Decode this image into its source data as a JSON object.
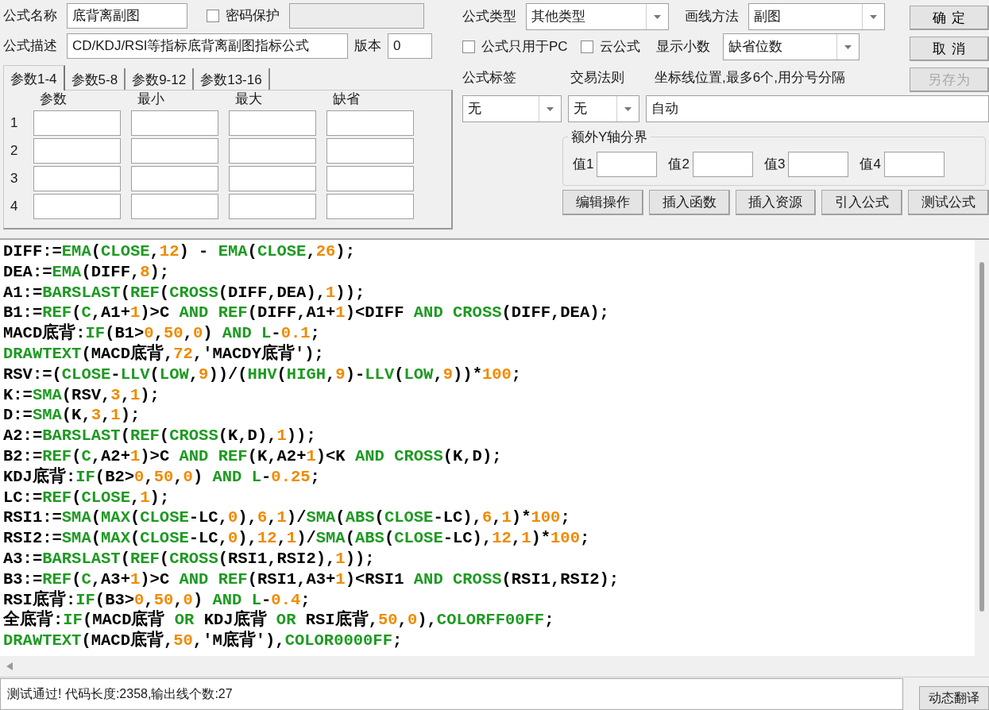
{
  "form": {
    "name_label": "公式名称",
    "name_value": "底背离副图",
    "password": {
      "label": "密码保护",
      "checked": false
    },
    "description_label": "公式描述",
    "description_value": "CD/KDJ/RSI等指标底背离副图指标公式",
    "version_label": "版本",
    "version_value": "0"
  },
  "param_tabs": [
    {
      "label": "参数1-4",
      "selected": true
    },
    {
      "label": "参数5-8",
      "selected": false
    },
    {
      "label": "参数9-12",
      "selected": false
    },
    {
      "label": "参数13-16",
      "selected": false
    }
  ],
  "param_columns": [
    "参数",
    "最小",
    "最大",
    "缺省"
  ],
  "param_rows": [
    "1",
    "2",
    "3",
    "4"
  ],
  "formula_type": {
    "label": "公式类型",
    "value": "其他类型"
  },
  "draw_method": {
    "label": "画线方法",
    "value": "副图"
  },
  "pc_only": {
    "label": "公式只用于PC",
    "checked": false
  },
  "cloud": {
    "label": "云公式",
    "checked": false
  },
  "decimals": {
    "label": "显示小数",
    "value": "缺省位数"
  },
  "tag": {
    "label": "公式标签",
    "value": "无"
  },
  "trade_rule": {
    "label": "交易法则",
    "value": "无"
  },
  "axis_lines": {
    "label": "坐标线位置,最多6个,用分号分隔",
    "value": "自动"
  },
  "y_bounds": {
    "title": "额外Y轴分界",
    "fields": [
      "值1",
      "值2",
      "值3",
      "值4"
    ]
  },
  "actions": [
    "编辑操作",
    "插入函数",
    "插入资源",
    "引入公式",
    "测试公式"
  ],
  "dialog_buttons": [
    {
      "label": "确 定",
      "disabled": false
    },
    {
      "label": "取 消",
      "disabled": false
    },
    {
      "label": "另存为",
      "disabled": true
    }
  ],
  "code_lines": [
    [
      {
        "kind": "text",
        "text": "DIFF:="
      },
      {
        "kind": "fn",
        "text": "EMA"
      },
      {
        "kind": "text",
        "text": "("
      },
      {
        "kind": "fn",
        "text": "CLOSE"
      },
      {
        "kind": "text",
        "text": ","
      },
      {
        "kind": "num",
        "text": "12"
      },
      {
        "kind": "text",
        "text": ") - "
      },
      {
        "kind": "fn",
        "text": "EMA"
      },
      {
        "kind": "text",
        "text": "("
      },
      {
        "kind": "fn",
        "text": "CLOSE"
      },
      {
        "kind": "text",
        "text": ","
      },
      {
        "kind": "num",
        "text": "26"
      },
      {
        "kind": "text",
        "text": ");"
      }
    ],
    [
      {
        "kind": "text",
        "text": "DEA:="
      },
      {
        "kind": "fn",
        "text": "EMA"
      },
      {
        "kind": "text",
        "text": "(DIFF,"
      },
      {
        "kind": "num",
        "text": "8"
      },
      {
        "kind": "text",
        "text": ");"
      }
    ],
    [
      {
        "kind": "text",
        "text": "A1:="
      },
      {
        "kind": "fn",
        "text": "BARSLAST"
      },
      {
        "kind": "text",
        "text": "("
      },
      {
        "kind": "fn",
        "text": "REF"
      },
      {
        "kind": "text",
        "text": "("
      },
      {
        "kind": "fn",
        "text": "CROSS"
      },
      {
        "kind": "text",
        "text": "(DIFF,DEA),"
      },
      {
        "kind": "num",
        "text": "1"
      },
      {
        "kind": "text",
        "text": "));"
      }
    ],
    [
      {
        "kind": "text",
        "text": "B1:="
      },
      {
        "kind": "fn",
        "text": "REF"
      },
      {
        "kind": "text",
        "text": "("
      },
      {
        "kind": "fn",
        "text": "C"
      },
      {
        "kind": "text",
        "text": ",A1+"
      },
      {
        "kind": "num",
        "text": "1"
      },
      {
        "kind": "text",
        "text": ")>C "
      },
      {
        "kind": "fn",
        "text": "AND REF"
      },
      {
        "kind": "text",
        "text": "(DIFF,A1+"
      },
      {
        "kind": "num",
        "text": "1"
      },
      {
        "kind": "text",
        "text": ")<DIFF "
      },
      {
        "kind": "fn",
        "text": "AND CROSS"
      },
      {
        "kind": "text",
        "text": "(DIFF,DEA);"
      }
    ],
    [
      {
        "kind": "text",
        "text": "MACD底背:"
      },
      {
        "kind": "fn",
        "text": "IF"
      },
      {
        "kind": "text",
        "text": "(B1>"
      },
      {
        "kind": "num",
        "text": "0"
      },
      {
        "kind": "text",
        "text": ","
      },
      {
        "kind": "num",
        "text": "50"
      },
      {
        "kind": "text",
        "text": ","
      },
      {
        "kind": "num",
        "text": "0"
      },
      {
        "kind": "text",
        "text": ") "
      },
      {
        "kind": "fn",
        "text": "AND L"
      },
      {
        "kind": "text",
        "text": "-"
      },
      {
        "kind": "num",
        "text": "0.1"
      },
      {
        "kind": "text",
        "text": ";"
      }
    ],
    [
      {
        "kind": "fn",
        "text": "DRAWTEXT"
      },
      {
        "kind": "text",
        "text": "(MACD底背,"
      },
      {
        "kind": "num",
        "text": "72"
      },
      {
        "kind": "text",
        "text": ",'MACDY底背');"
      }
    ],
    [
      {
        "kind": "text",
        "text": "RSV:=("
      },
      {
        "kind": "fn",
        "text": "CLOSE"
      },
      {
        "kind": "text",
        "text": "-"
      },
      {
        "kind": "fn",
        "text": "LLV"
      },
      {
        "kind": "text",
        "text": "("
      },
      {
        "kind": "fn",
        "text": "LOW"
      },
      {
        "kind": "text",
        "text": ","
      },
      {
        "kind": "num",
        "text": "9"
      },
      {
        "kind": "text",
        "text": "))/("
      },
      {
        "kind": "fn",
        "text": "HHV"
      },
      {
        "kind": "text",
        "text": "("
      },
      {
        "kind": "fn",
        "text": "HIGH"
      },
      {
        "kind": "text",
        "text": ","
      },
      {
        "kind": "num",
        "text": "9"
      },
      {
        "kind": "text",
        "text": ")-"
      },
      {
        "kind": "fn",
        "text": "LLV"
      },
      {
        "kind": "text",
        "text": "("
      },
      {
        "kind": "fn",
        "text": "LOW"
      },
      {
        "kind": "text",
        "text": ","
      },
      {
        "kind": "num",
        "text": "9"
      },
      {
        "kind": "text",
        "text": "))*"
      },
      {
        "kind": "num",
        "text": "100"
      },
      {
        "kind": "text",
        "text": ";"
      }
    ],
    [
      {
        "kind": "text",
        "text": "K:="
      },
      {
        "kind": "fn",
        "text": "SMA"
      },
      {
        "kind": "text",
        "text": "(RSV,"
      },
      {
        "kind": "num",
        "text": "3"
      },
      {
        "kind": "text",
        "text": ","
      },
      {
        "kind": "num",
        "text": "1"
      },
      {
        "kind": "text",
        "text": ");"
      }
    ],
    [
      {
        "kind": "text",
        "text": "D:="
      },
      {
        "kind": "fn",
        "text": "SMA"
      },
      {
        "kind": "text",
        "text": "(K,"
      },
      {
        "kind": "num",
        "text": "3"
      },
      {
        "kind": "text",
        "text": ","
      },
      {
        "kind": "num",
        "text": "1"
      },
      {
        "kind": "text",
        "text": ");"
      }
    ],
    [
      {
        "kind": "text",
        "text": "A2:="
      },
      {
        "kind": "fn",
        "text": "BARSLAST"
      },
      {
        "kind": "text",
        "text": "("
      },
      {
        "kind": "fn",
        "text": "REF"
      },
      {
        "kind": "text",
        "text": "("
      },
      {
        "kind": "fn",
        "text": "CROSS"
      },
      {
        "kind": "text",
        "text": "(K,D),"
      },
      {
        "kind": "num",
        "text": "1"
      },
      {
        "kind": "text",
        "text": "));"
      }
    ],
    [
      {
        "kind": "text",
        "text": "B2:="
      },
      {
        "kind": "fn",
        "text": "REF"
      },
      {
        "kind": "text",
        "text": "("
      },
      {
        "kind": "fn",
        "text": "C"
      },
      {
        "kind": "text",
        "text": ",A2+"
      },
      {
        "kind": "num",
        "text": "1"
      },
      {
        "kind": "text",
        "text": ")>C "
      },
      {
        "kind": "fn",
        "text": "AND REF"
      },
      {
        "kind": "text",
        "text": "(K,A2+"
      },
      {
        "kind": "num",
        "text": "1"
      },
      {
        "kind": "text",
        "text": ")<K "
      },
      {
        "kind": "fn",
        "text": "AND CROSS"
      },
      {
        "kind": "text",
        "text": "(K,D);"
      }
    ],
    [
      {
        "kind": "text",
        "text": "KDJ底背:"
      },
      {
        "kind": "fn",
        "text": "IF"
      },
      {
        "kind": "text",
        "text": "(B2>"
      },
      {
        "kind": "num",
        "text": "0"
      },
      {
        "kind": "text",
        "text": ","
      },
      {
        "kind": "num",
        "text": "50"
      },
      {
        "kind": "text",
        "text": ","
      },
      {
        "kind": "num",
        "text": "0"
      },
      {
        "kind": "text",
        "text": ") "
      },
      {
        "kind": "fn",
        "text": "AND L"
      },
      {
        "kind": "text",
        "text": "-"
      },
      {
        "kind": "num",
        "text": "0.25"
      },
      {
        "kind": "text",
        "text": ";"
      }
    ],
    [
      {
        "kind": "text",
        "text": "LC:="
      },
      {
        "kind": "fn",
        "text": "REF"
      },
      {
        "kind": "text",
        "text": "("
      },
      {
        "kind": "fn",
        "text": "CLOSE"
      },
      {
        "kind": "text",
        "text": ","
      },
      {
        "kind": "num",
        "text": "1"
      },
      {
        "kind": "text",
        "text": ");"
      }
    ],
    [
      {
        "kind": "text",
        "text": "RSI1:="
      },
      {
        "kind": "fn",
        "text": "SMA"
      },
      {
        "kind": "text",
        "text": "("
      },
      {
        "kind": "fn",
        "text": "MAX"
      },
      {
        "kind": "text",
        "text": "("
      },
      {
        "kind": "fn",
        "text": "CLOSE"
      },
      {
        "kind": "text",
        "text": "-LC,"
      },
      {
        "kind": "num",
        "text": "0"
      },
      {
        "kind": "text",
        "text": "),"
      },
      {
        "kind": "num",
        "text": "6"
      },
      {
        "kind": "text",
        "text": ","
      },
      {
        "kind": "num",
        "text": "1"
      },
      {
        "kind": "text",
        "text": ")/"
      },
      {
        "kind": "fn",
        "text": "SMA"
      },
      {
        "kind": "text",
        "text": "("
      },
      {
        "kind": "fn",
        "text": "ABS"
      },
      {
        "kind": "text",
        "text": "("
      },
      {
        "kind": "fn",
        "text": "CLOSE"
      },
      {
        "kind": "text",
        "text": "-LC),"
      },
      {
        "kind": "num",
        "text": "6"
      },
      {
        "kind": "text",
        "text": ","
      },
      {
        "kind": "num",
        "text": "1"
      },
      {
        "kind": "text",
        "text": ")*"
      },
      {
        "kind": "num",
        "text": "100"
      },
      {
        "kind": "text",
        "text": ";"
      }
    ],
    [
      {
        "kind": "text",
        "text": "RSI2:="
      },
      {
        "kind": "fn",
        "text": "SMA"
      },
      {
        "kind": "text",
        "text": "("
      },
      {
        "kind": "fn",
        "text": "MAX"
      },
      {
        "kind": "text",
        "text": "("
      },
      {
        "kind": "fn",
        "text": "CLOSE"
      },
      {
        "kind": "text",
        "text": "-LC,"
      },
      {
        "kind": "num",
        "text": "0"
      },
      {
        "kind": "text",
        "text": "),"
      },
      {
        "kind": "num",
        "text": "12"
      },
      {
        "kind": "text",
        "text": ","
      },
      {
        "kind": "num",
        "text": "1"
      },
      {
        "kind": "text",
        "text": ")/"
      },
      {
        "kind": "fn",
        "text": "SMA"
      },
      {
        "kind": "text",
        "text": "("
      },
      {
        "kind": "fn",
        "text": "ABS"
      },
      {
        "kind": "text",
        "text": "("
      },
      {
        "kind": "fn",
        "text": "CLOSE"
      },
      {
        "kind": "text",
        "text": "-LC),"
      },
      {
        "kind": "num",
        "text": "12"
      },
      {
        "kind": "text",
        "text": ","
      },
      {
        "kind": "num",
        "text": "1"
      },
      {
        "kind": "text",
        "text": ")*"
      },
      {
        "kind": "num",
        "text": "100"
      },
      {
        "kind": "text",
        "text": ";"
      }
    ],
    [
      {
        "kind": "text",
        "text": "A3:="
      },
      {
        "kind": "fn",
        "text": "BARSLAST"
      },
      {
        "kind": "text",
        "text": "("
      },
      {
        "kind": "fn",
        "text": "REF"
      },
      {
        "kind": "text",
        "text": "("
      },
      {
        "kind": "fn",
        "text": "CROSS"
      },
      {
        "kind": "text",
        "text": "(RSI1,RSI2),"
      },
      {
        "kind": "num",
        "text": "1"
      },
      {
        "kind": "text",
        "text": "));"
      }
    ],
    [
      {
        "kind": "text",
        "text": "B3:="
      },
      {
        "kind": "fn",
        "text": "REF"
      },
      {
        "kind": "text",
        "text": "("
      },
      {
        "kind": "fn",
        "text": "C"
      },
      {
        "kind": "text",
        "text": ",A3+"
      },
      {
        "kind": "num",
        "text": "1"
      },
      {
        "kind": "text",
        "text": ")>C "
      },
      {
        "kind": "fn",
        "text": "AND REF"
      },
      {
        "kind": "text",
        "text": "(RSI1,A3+"
      },
      {
        "kind": "num",
        "text": "1"
      },
      {
        "kind": "text",
        "text": ")<RSI1 "
      },
      {
        "kind": "fn",
        "text": "AND CROSS"
      },
      {
        "kind": "text",
        "text": "(RSI1,RSI2);"
      }
    ],
    [
      {
        "kind": "text",
        "text": "RSI底背:"
      },
      {
        "kind": "fn",
        "text": "IF"
      },
      {
        "kind": "text",
        "text": "(B3>"
      },
      {
        "kind": "num",
        "text": "0"
      },
      {
        "kind": "text",
        "text": ","
      },
      {
        "kind": "num",
        "text": "50"
      },
      {
        "kind": "text",
        "text": ","
      },
      {
        "kind": "num",
        "text": "0"
      },
      {
        "kind": "text",
        "text": ") "
      },
      {
        "kind": "fn",
        "text": "AND L"
      },
      {
        "kind": "text",
        "text": "-"
      },
      {
        "kind": "num",
        "text": "0.4"
      },
      {
        "kind": "text",
        "text": ";"
      }
    ],
    [
      {
        "kind": "text",
        "text": "全底背:"
      },
      {
        "kind": "fn",
        "text": "IF"
      },
      {
        "kind": "text",
        "text": "(MACD底背 "
      },
      {
        "kind": "fn",
        "text": "OR"
      },
      {
        "kind": "text",
        "text": " KDJ底背 "
      },
      {
        "kind": "fn",
        "text": "OR"
      },
      {
        "kind": "text",
        "text": " RSI底背,"
      },
      {
        "kind": "num",
        "text": "50"
      },
      {
        "kind": "text",
        "text": ","
      },
      {
        "kind": "num",
        "text": "0"
      },
      {
        "kind": "text",
        "text": "),"
      },
      {
        "kind": "fn",
        "text": "COLORFF00FF"
      },
      {
        "kind": "text",
        "text": ";"
      }
    ],
    [
      {
        "kind": "fn",
        "text": "DRAWTEXT"
      },
      {
        "kind": "text",
        "text": "(MACD底背,"
      },
      {
        "kind": "num",
        "text": "50"
      },
      {
        "kind": "text",
        "text": ",'M底背'),"
      },
      {
        "kind": "fn",
        "text": "COLOR0000FF"
      },
      {
        "kind": "text",
        "text": ";"
      }
    ]
  ],
  "status": "测试通过! 代码长度:2358,输出线个数:27",
  "translate_button": "动态翻译"
}
